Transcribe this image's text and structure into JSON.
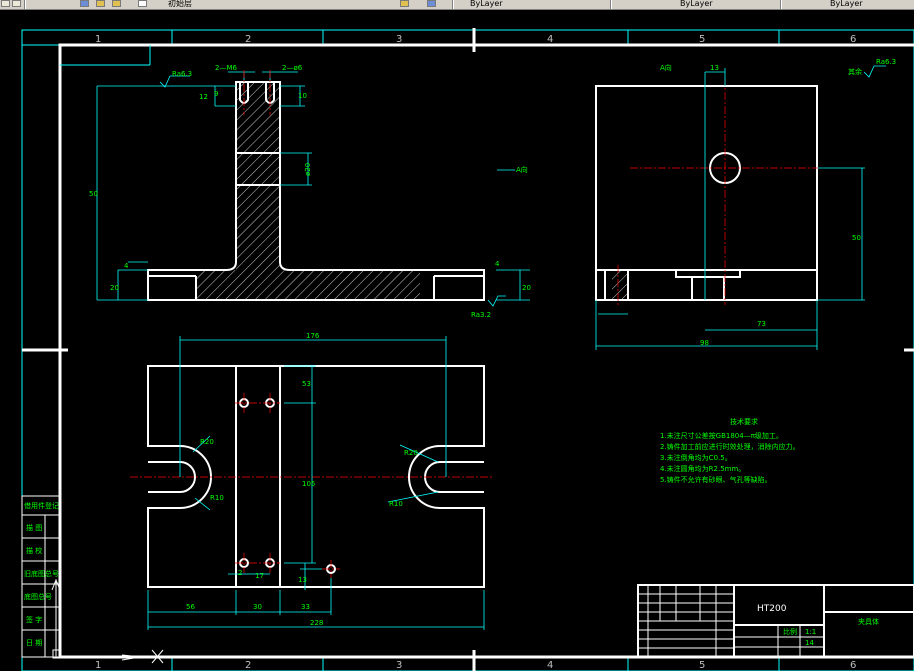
{
  "toolbar": {
    "layer_label": "初始层",
    "byblock1": "ByLayer",
    "byblock2": "ByLayer",
    "byblock3": "ByLayer"
  },
  "zones": [
    "1",
    "2",
    "3",
    "4",
    "5",
    "6"
  ],
  "bottom_zones": [
    "1",
    "2",
    "3",
    "4",
    "5",
    "6"
  ],
  "views": {
    "front": {
      "callouts": [
        "2—M6",
        "2—ø6"
      ],
      "dims": [
        "12",
        "9",
        "10",
        "ø20",
        "4",
        "20",
        "4",
        "20",
        "50"
      ],
      "rough": [
        "Ra6.3",
        "Ra3.2"
      ]
    },
    "side": {
      "label": "A向",
      "dims": [
        "13",
        "73",
        "50",
        "98"
      ],
      "rough": "Ra6.3",
      "rough_prefix": "其余"
    },
    "plan": {
      "dims": [
        "176",
        "53",
        "105",
        "56",
        "30",
        "33",
        "17",
        "13",
        "2",
        "R20",
        "R10",
        "R20",
        "R10",
        "228"
      ],
      "arrow_label": "A向"
    }
  },
  "tech_notes": {
    "title": "技术要求",
    "lines": [
      "1.未注尺寸公差按GB1804—π级加工。",
      "2.铸件加工前应进行时效处理，消除内应力。",
      "3.未注倒角均为C0.5。",
      "4.未注圆角均为R2.5mm。",
      "5.铸件不允许有砂眼、气孔等缺陷。"
    ]
  },
  "title_block": {
    "material": "HT200",
    "part_name": "夹具体",
    "scale_label": "比例",
    "scale": "1:1",
    "sheets": "14"
  },
  "left_strip": [
    "借用件登记",
    "描 图",
    "描 校",
    "旧底图总号",
    "底图总号",
    "签 字",
    "日 期"
  ],
  "colors": {
    "outline": "#ffffff",
    "dimension": "#00ffff",
    "centerline": "#ff0000",
    "text": "#00ff00"
  }
}
